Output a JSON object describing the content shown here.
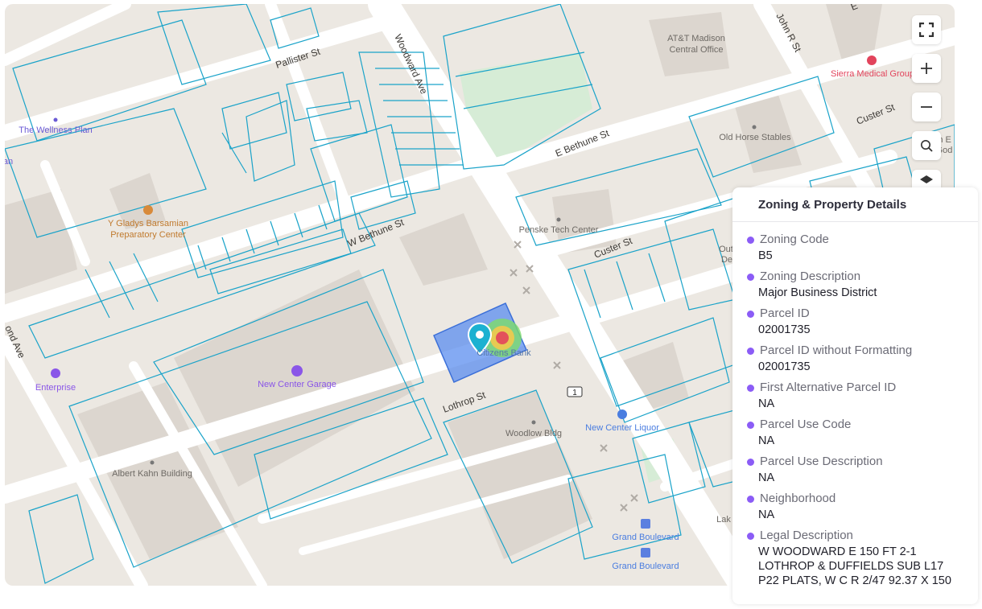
{
  "map": {
    "streets": {
      "pallister": "Pallister St",
      "woodward": "Woodward Ave",
      "john_r": "John R St",
      "e_bethune": "E Bethune St",
      "custer_upper": "Custer St",
      "w_bethune": "W Bethune St",
      "custer_lower": "Custer St",
      "lothrop": "Lothrop St",
      "woodward_left": "ond Ave",
      "e_cut": "E",
      "route_shield": "1"
    },
    "pois": {
      "att": "AT&T Madison",
      "att2": "Central Office",
      "sierra": "Sierra Medical Group",
      "wellness": "The Wellness Plan",
      "old_horse": "Old Horse Stables",
      "gladys1": "Y Gladys Barsamian",
      "gladys2": "Preparatory Center",
      "penske": "Penske Tech Center",
      "new_center_garage": "New Center Garage",
      "enterprise": "Enterprise",
      "woodlow": "Woodlow Bldg",
      "new_center_liquor": "New Center Liquor",
      "albert_kahn": "Albert Kahn Building",
      "grand_blvd_1": "Grand Boulevard",
      "grand_blvd_2": "Grand Boulevard",
      "citizens": "Citizens Bank",
      "out": "Out",
      "de": "De",
      "lak": "Lak",
      "an": "an",
      "nth": "nth E",
      "god": "God"
    },
    "colors": {
      "parcel_line": "#1aa3c9",
      "selected_parcel": "#5b8def",
      "poi_purple": "#8a56e8",
      "poi_red": "#e2445c",
      "poi_orange": "#d88a3a",
      "marker": "#1bb1d1"
    }
  },
  "controls": {
    "fullscreen": "fullscreen-icon",
    "zoom_in": "plus-icon",
    "zoom_out": "minus-icon",
    "search": "search-icon",
    "layers": "layers-icon"
  },
  "panel": {
    "title": "Zoning & Property Details",
    "bullet_color": "#8b5cf6",
    "fields": [
      {
        "label": "Zoning Code",
        "value": "B5"
      },
      {
        "label": "Zoning Description",
        "value": "Major Business District"
      },
      {
        "label": "Parcel ID",
        "value": "02001735"
      },
      {
        "label": "Parcel ID without Formatting",
        "value": "02001735"
      },
      {
        "label": "First Alternative Parcel ID",
        "value": "NA"
      },
      {
        "label": "Parcel Use Code",
        "value": "NA"
      },
      {
        "label": "Parcel Use Description",
        "value": "NA"
      },
      {
        "label": "Neighborhood",
        "value": "NA"
      },
      {
        "label": "Legal Description",
        "value": "W WOODWARD E 150 FT 2-1\nLOTHROP & DUFFIELDS SUB L17\nP22 PLATS, W C R 2/47 92.37 X 150"
      }
    ]
  }
}
